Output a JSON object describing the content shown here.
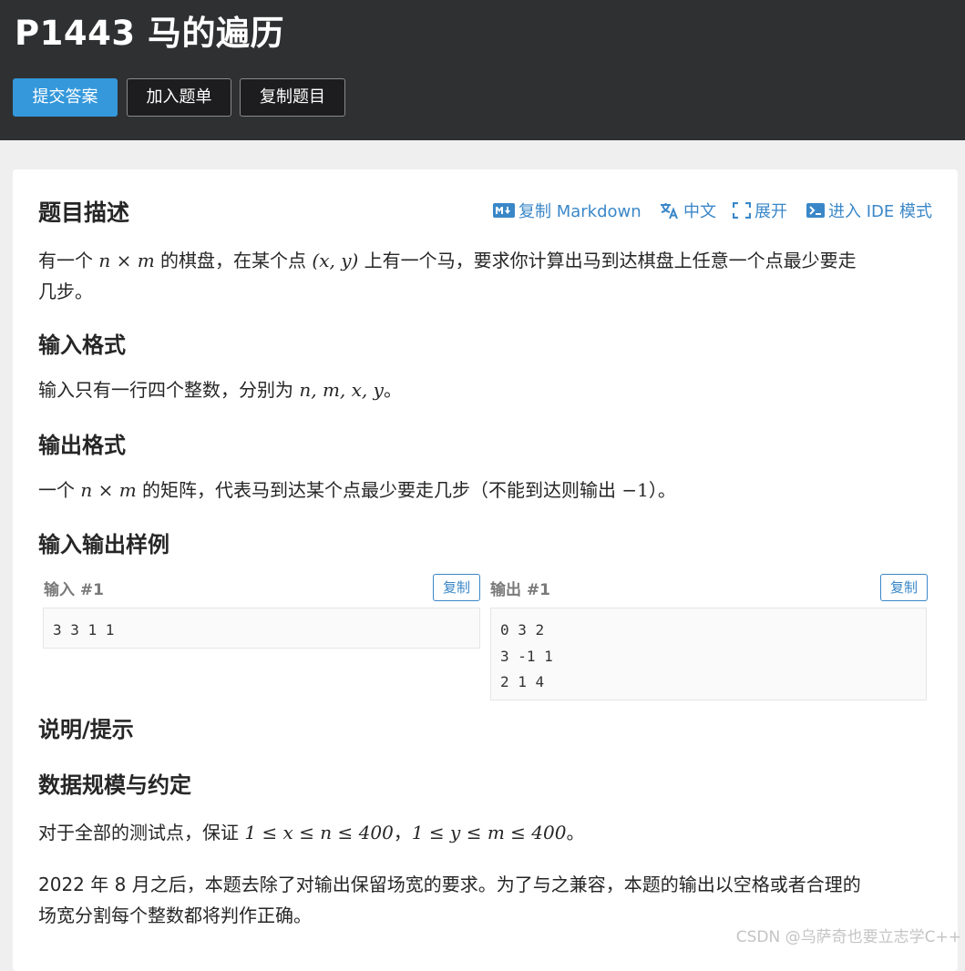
{
  "header": {
    "title": "P1443 马的遍历",
    "submit_label": "提交答案",
    "add_list_label": "加入题单",
    "copy_problem_label": "复制题目"
  },
  "toolbar": {
    "copy_markdown": "复制 Markdown",
    "chinese": "中文",
    "expand": "展开",
    "ide_mode": "进入 IDE 模式"
  },
  "sections": {
    "description_title": "题目描述",
    "description_pre": "有一个 ",
    "description_mid1": " 的棋盘，在某个点 ",
    "description_mid2": " 上有一个马，要求你计算出马到达棋盘上任意一个点最少要走",
    "description_line2": "几步。",
    "input_title": "输入格式",
    "input_text": "输入只有一行四个整数，分别为 ",
    "output_title": "输出格式",
    "output_pre": "一个 ",
    "output_mid": " 的矩阵，代表马到达某个点最少要走几步（不能到达则输出 ",
    "output_post": "）。",
    "samples_title": "输入输出样例",
    "hint_title": "说明/提示",
    "scale_title": "数据规模与约定",
    "scale_pre": "对于全部的测试点，保证 ",
    "scale_mid": "，",
    "scale_post": "。",
    "note_line1": "2022 年 8 月之后，本题去除了对输出保留场宽的要求。为了与之兼容，本题的输出以空格或者合理的",
    "note_line2": "场宽分割每个整数都将判作正确。"
  },
  "math": {
    "n": "n",
    "times": "×",
    "m": "m",
    "point": "(x, y)",
    "vars": "n, m, x, y",
    "full_stop": "。",
    "neg_one": "−1",
    "cond1": "1 ≤ x ≤ n ≤ 400",
    "cond2": "1 ≤ y ≤ m ≤ 400"
  },
  "samples": {
    "input_label": "输入 #1",
    "output_label": "输出 #1",
    "copy_label": "复制",
    "input_data": "3 3 1 1",
    "output_data": "0 3 2\n3 -1 1\n2 1 4"
  },
  "watermark": "CSDN @乌萨奇也要立志学C++",
  "colors": {
    "header_bg": "#2f3032",
    "primary": "#3498db",
    "link": "#3a87c8"
  },
  "icons": [
    "markdown-icon",
    "translate-icon",
    "expand-icon",
    "terminal-icon"
  ]
}
